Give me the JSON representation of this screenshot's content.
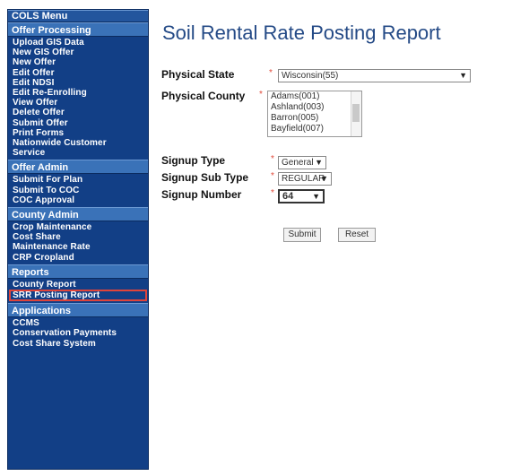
{
  "sidebar": {
    "title": "COLS Menu",
    "sections": [
      {
        "header": "Offer Processing",
        "items": [
          "Upload GIS Data",
          "New GIS Offer",
          "New Offer",
          "Edit Offer",
          "Edit NDSI",
          "Edit Re-Enrolling",
          "View Offer",
          "Delete Offer",
          "Submit Offer",
          "Print Forms",
          "Nationwide Customer",
          "Service"
        ]
      },
      {
        "header": "Offer Admin",
        "items": [
          "Submit For Plan",
          "Submit To COC",
          "COC Approval"
        ]
      },
      {
        "header": "County Admin",
        "items": [
          "Crop Maintenance",
          "Cost Share",
          "Maintenance Rate",
          "CRP Cropland"
        ]
      },
      {
        "header": "Reports",
        "items": [
          "County Report",
          "SRR Posting Report"
        ]
      },
      {
        "header": "Applications",
        "items": [
          "CCMS",
          "Conservation Payments",
          "Cost Share System"
        ]
      }
    ]
  },
  "main": {
    "title": "Soil Rental Rate Posting Report",
    "required_mark": "*",
    "physical_state": {
      "label": "Physical State",
      "value": "Wisconsin(55)"
    },
    "physical_county": {
      "label": "Physical County",
      "options": [
        "Adams(001)",
        "Ashland(003)",
        "Barron(005)",
        "Bayfield(007)"
      ]
    },
    "signup_type": {
      "label": "Signup Type",
      "value": "General"
    },
    "signup_sub_type": {
      "label": "Signup Sub Type",
      "value": "REGULAR"
    },
    "signup_number": {
      "label": "Signup Number",
      "value": "64"
    },
    "submit_label": "Submit",
    "reset_label": "Reset"
  }
}
